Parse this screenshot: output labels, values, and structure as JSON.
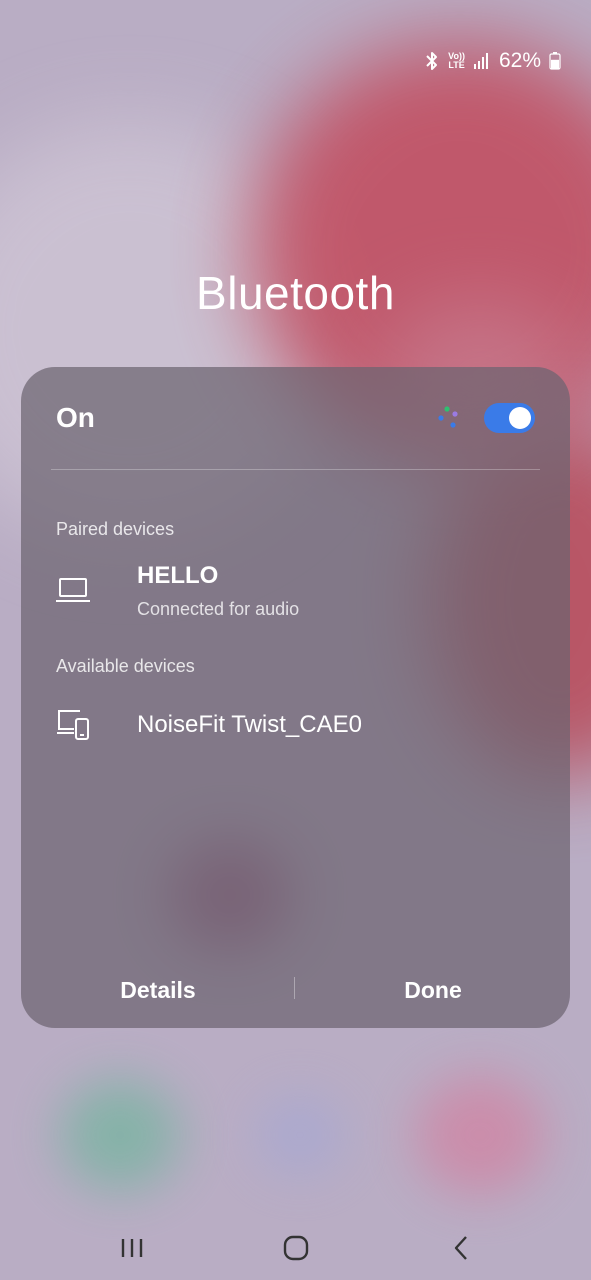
{
  "status_bar": {
    "bluetooth_icon": "bluetooth-icon",
    "volte_line1": "Vo))",
    "volte_line2": "LTE",
    "signal_icon": "signal-bars-icon",
    "battery_text": "62%",
    "battery_icon": "battery-icon",
    "battery_level": 0.62
  },
  "title": "Bluetooth",
  "panel": {
    "status_label": "On",
    "scan_icon": "scanning-dots-icon",
    "toggle_on": true,
    "accent_color": "#3a7be8",
    "paired_section": "Paired devices",
    "paired_devices": [
      {
        "name": "HELLO",
        "status": "Connected for audio",
        "icon": "laptop-icon"
      }
    ],
    "available_section": "Available devices",
    "available_devices": [
      {
        "name": "NoiseFit Twist_CAE0",
        "icon": "multi-device-icon"
      }
    ],
    "details_button": "Details",
    "done_button": "Done"
  },
  "nav_bar": {
    "recents_icon": "recents-icon",
    "home_icon": "home-icon",
    "back_icon": "back-icon"
  }
}
